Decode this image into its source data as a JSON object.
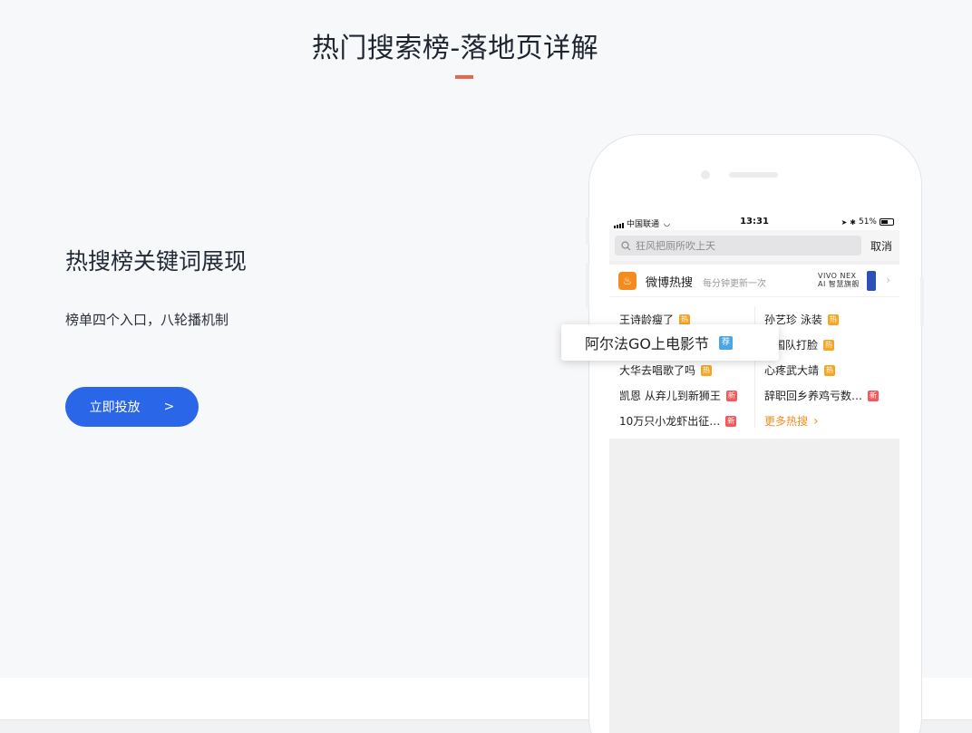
{
  "header": {
    "title": "热门搜索榜-落地页详解"
  },
  "section": {
    "heading": "热搜榜关键词展现",
    "description": "榜单四个入口，八轮播机制",
    "cta_label": "立即投放",
    "cta_arrow": ">"
  },
  "phone": {
    "status": {
      "carrier": "中国联通",
      "time": "13:31",
      "battery": "51%"
    },
    "search": {
      "placeholder": "狂风把厕所吹上天",
      "cancel": "取消"
    },
    "panel": {
      "title": "微博热搜",
      "subtitle": "每分钟更新一次",
      "ad_line1": "VIVO NEX",
      "ad_line2": "AI 智慧旗舰",
      "items_left": [
        {
          "text": "王诗龄瘦了",
          "badge": "热"
        },
        {
          "text": "",
          "badge": ""
        },
        {
          "text": "大华去唱歌了吗",
          "badge": "热"
        },
        {
          "text": "凯恩 从弃儿到新狮王",
          "badge": "新"
        },
        {
          "text": "10万只小龙虾出征…",
          "badge": "新"
        }
      ],
      "items_right": [
        {
          "text": "孙艺珍 泳装",
          "badge": "热"
        },
        {
          "text": "国队打脸",
          "badge": "热"
        },
        {
          "text": "心疼武大靖",
          "badge": "热"
        },
        {
          "text": "辞职回乡养鸡亏数…",
          "badge": "新"
        },
        {
          "text": "更多热搜",
          "badge": ""
        }
      ]
    },
    "popup": {
      "text": "阿尔法GO上电影节",
      "badge": "荐"
    }
  },
  "colors": {
    "accent": "#2a67e8",
    "title_underline": "#e8664a",
    "hot_badge": "#f5a623",
    "new_badge": "#f2585c",
    "rec_badge": "#4aa6e6"
  }
}
